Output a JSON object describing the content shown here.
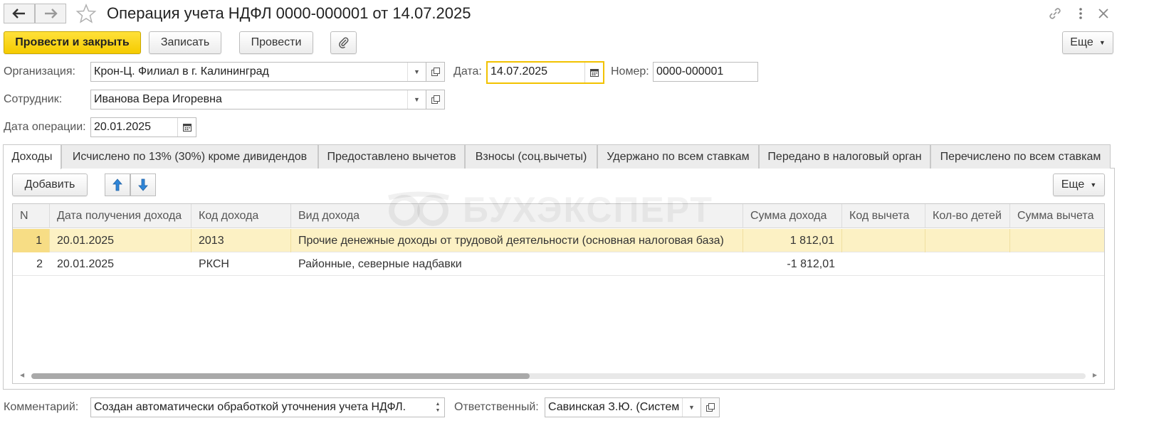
{
  "window": {
    "title": "Операция учета НДФЛ 0000-000001 от 14.07.2025"
  },
  "toolbar": {
    "post_close_label": "Провести и закрыть",
    "save_label": "Записать",
    "post_label": "Провести",
    "more_label": "Еще"
  },
  "form": {
    "organization_label": "Организация:",
    "organization_value": "Крон-Ц. Филиал в г. Калининград",
    "date_label": "Дата:",
    "date_value": "14.07.2025",
    "number_label": "Номер:",
    "number_value": "0000-000001",
    "employee_label": "Сотрудник:",
    "employee_value": "Иванова Вера Игоревна",
    "operation_date_label": "Дата операции:",
    "operation_date_value": "20.01.2025"
  },
  "tabs": [
    {
      "label": "Доходы",
      "active": true
    },
    {
      "label": "Исчислено по 13% (30%) кроме дивидендов"
    },
    {
      "label": "Предоставлено вычетов"
    },
    {
      "label": "Взносы (соц.вычеты)"
    },
    {
      "label": "Удержано по всем ставкам"
    },
    {
      "label": "Передано в налоговый орган"
    },
    {
      "label": "Перечислено по всем ставкам"
    }
  ],
  "table_toolbar": {
    "add_label": "Добавить",
    "more_label": "Еще"
  },
  "watermark": "БУХЭКСПЕРТ",
  "table": {
    "columns": [
      "N",
      "Дата получения дохода",
      "Код дохода",
      "Вид дохода",
      "Сумма дохода",
      "Код вычета",
      "Кол-во детей",
      "Сумма вычета"
    ],
    "rows": [
      {
        "n": "1",
        "date": "20.01.2025",
        "code": "2013",
        "type": "Прочие денежные доходы от трудовой деятельности (основная налоговая база)",
        "amount": "1 812,01",
        "deduction_code": "",
        "children": "",
        "deduction_amount": ""
      },
      {
        "n": "2",
        "date": "20.01.2025",
        "code": "РКСН",
        "type": "Районные, северные надбавки",
        "amount": "-1 812,01",
        "deduction_code": "",
        "children": "",
        "deduction_amount": ""
      }
    ]
  },
  "footer": {
    "comment_label": "Комментарий:",
    "comment_value": "Создан автоматически обработкой уточнения учета НДФЛ.",
    "responsible_label": "Ответственный:",
    "responsible_value": "Савинская З.Ю. (Систем"
  },
  "colors": {
    "primary_button": "#f5cb00",
    "focus_border": "#f2c200",
    "selected_row": "#fcf1c4",
    "move_arrows": "#2f86d8"
  }
}
